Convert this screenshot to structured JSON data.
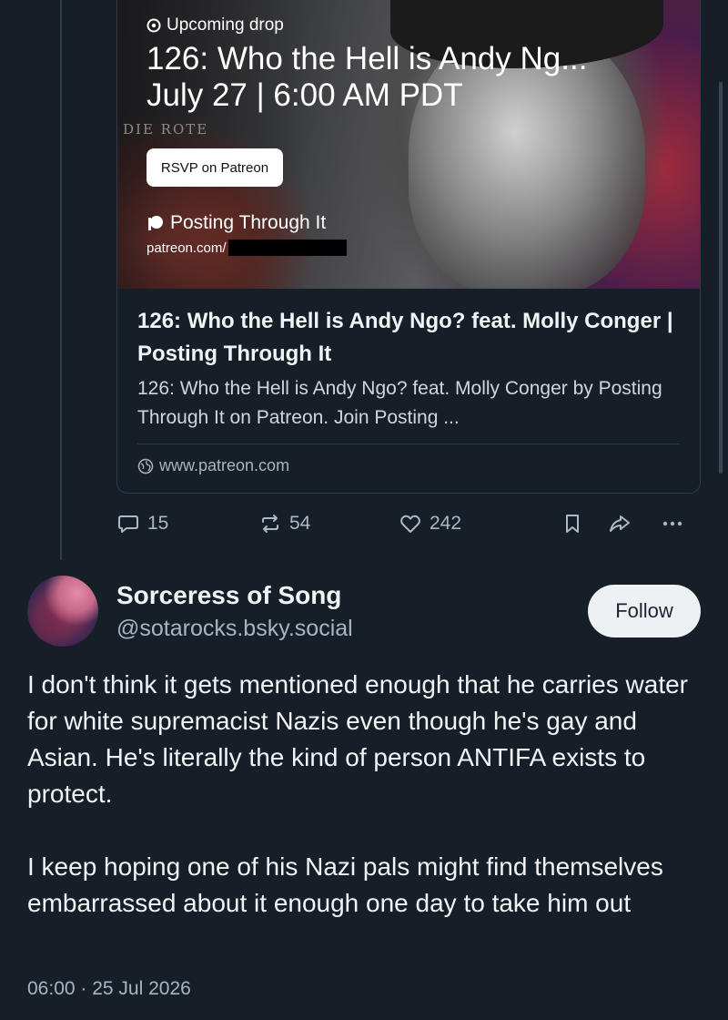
{
  "embed": {
    "drop_label": "Upcoming drop",
    "drop_title": "126: Who the Hell is Andy Ng...",
    "drop_date": "July 27 | 6:00 AM PDT",
    "background_text": "DIE ROTE",
    "rsvp_label": "RSVP on Patreon",
    "creator_name": "Posting Through It",
    "creator_url": "patreon.com/",
    "link_title": "126: Who the Hell is Andy Ngo? feat. Molly Conger | Posting Through It",
    "link_description": "126: Who the Hell is Andy Ngo? feat. Molly Conger by Posting Through It on Patreon. Join Posting ...",
    "link_domain": "www.patreon.com"
  },
  "actions": {
    "replies": "15",
    "reposts": "54",
    "likes": "242"
  },
  "reply": {
    "display_name": "Sorceress of Song",
    "handle": "@sotarocks.bsky.social",
    "follow_label": "Follow",
    "paragraphs": [
      "I don't think it gets mentioned enough that he carries water for white supremacist Nazis even though he's gay and Asian. He's literally the kind of person ANTIFA exists to protect.",
      "I keep hoping one of his Nazi pals might find themselves embarrassed about it enough one day to take him out"
    ],
    "timestamp": "06:00 · 25 Jul 2026"
  },
  "colors": {
    "background": "#161e27",
    "border": "#2e3b4a",
    "muted_text": "#aab4c0",
    "follow_bg": "#eef1f4"
  }
}
